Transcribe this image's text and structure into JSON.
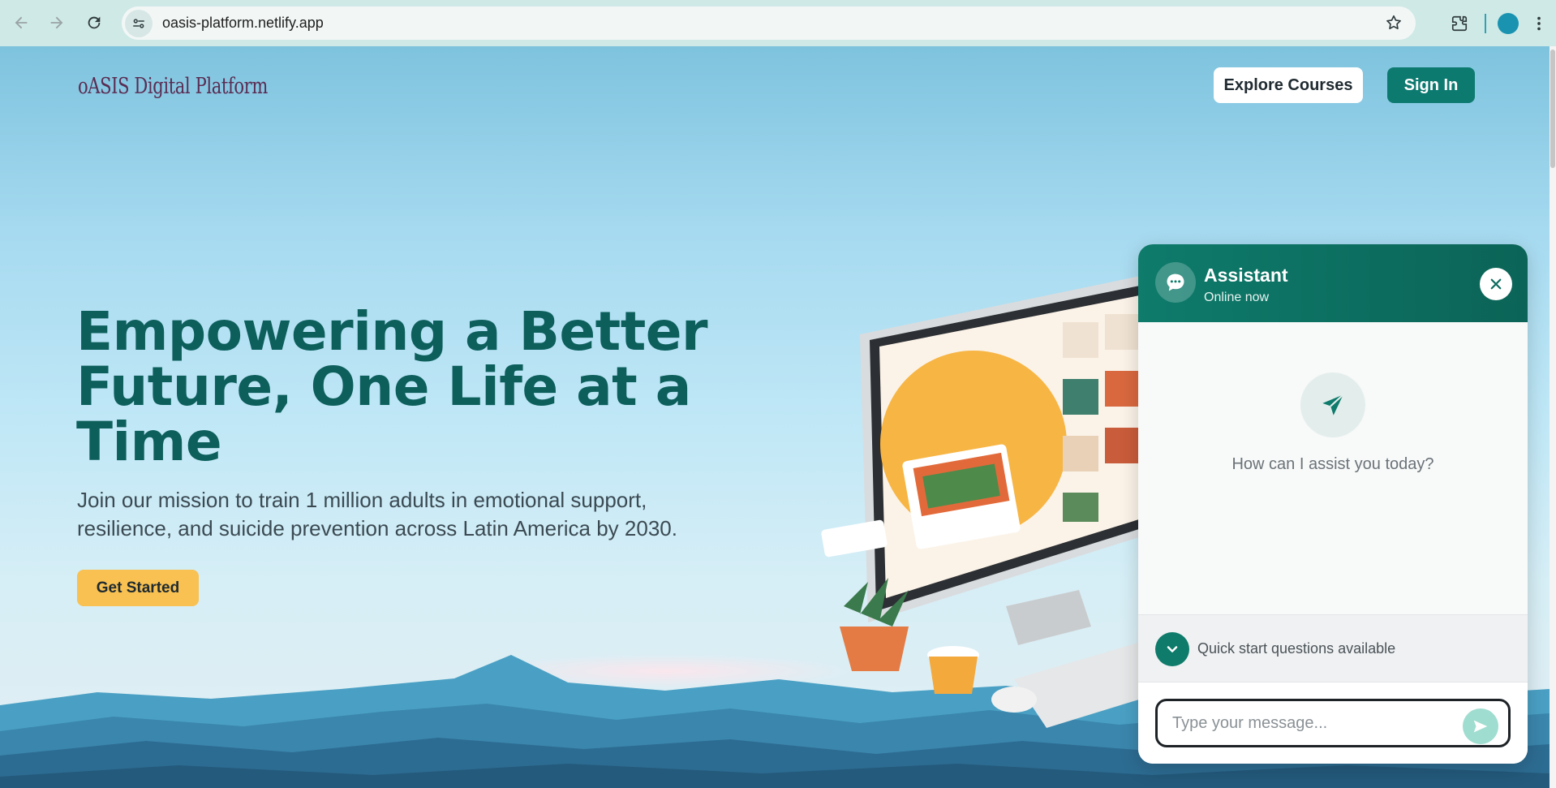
{
  "browser": {
    "url": "oasis-platform.netlify.app",
    "icons": [
      "back-icon",
      "forward-icon",
      "reload-icon",
      "site-info-icon",
      "bookmark-star-icon",
      "extensions-icon",
      "profile-avatar",
      "menu-kebab-icon"
    ]
  },
  "header": {
    "logo_text": "oASIS Digital Platform",
    "explore_label": "Explore Courses",
    "signin_label": "Sign In"
  },
  "hero": {
    "title": "Empowering a Better Future, One Life at a Time",
    "subtitle": "Join our mission to train 1 million adults in emotional support, resilience, and suicide prevention across Latin America by 2030.",
    "cta_label": "Get Started"
  },
  "chat": {
    "title": "Assistant",
    "status": "Online now",
    "prompt": "How can I assist you today?",
    "quick_label": "Quick start questions available",
    "input_placeholder": "Type your message..."
  },
  "colors": {
    "brand_teal": "#0d7a70",
    "title_teal": "#0d5f5c",
    "cta_yellow": "#f8c152",
    "logo_purple": "#5a2c52"
  }
}
